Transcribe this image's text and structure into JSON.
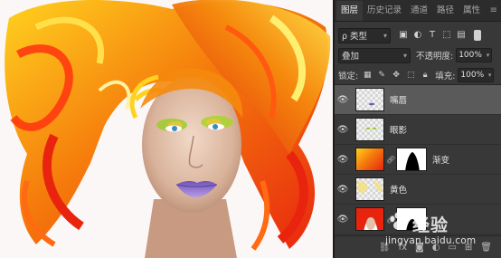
{
  "panel": {
    "tabs": [
      "图层",
      "历史记录",
      "通道",
      "路径",
      "属性"
    ],
    "active_tab": "图层",
    "filter": {
      "kind_label": "ρ 类型"
    },
    "blend_mode": "叠加",
    "opacity_label": "不透明度:",
    "opacity_value": "100%",
    "lock_label": "锁定:",
    "fill_label": "填充:",
    "fill_value": "100%",
    "layers": [
      {
        "name": "嘴唇",
        "visible": true,
        "selected": true,
        "thumb": "transparent-blue"
      },
      {
        "name": "眼影",
        "visible": true,
        "selected": false,
        "thumb": "transparent-green"
      },
      {
        "name": "渐变",
        "visible": true,
        "selected": false,
        "thumb": "gradient",
        "has_mask": true
      },
      {
        "name": "黄色",
        "visible": true,
        "selected": false,
        "thumb": "transparent-yellow"
      },
      {
        "name": "",
        "visible": true,
        "selected": false,
        "thumb": "hair",
        "has_mask": true
      }
    ]
  },
  "watermark": {
    "brand": "经验",
    "url": "jingyan.baidu.com"
  },
  "colors": {
    "panel_bg": "#383838",
    "tab_bar": "#2c2c2c",
    "selected_row": "#5a5a5a",
    "hair_red": "#e8240f",
    "hair_orange": "#f57c0c",
    "hair_yellow": "#ffd21f",
    "lips_purple": "#8a6cc9",
    "eyeshadow_green": "#9ccb2d"
  }
}
